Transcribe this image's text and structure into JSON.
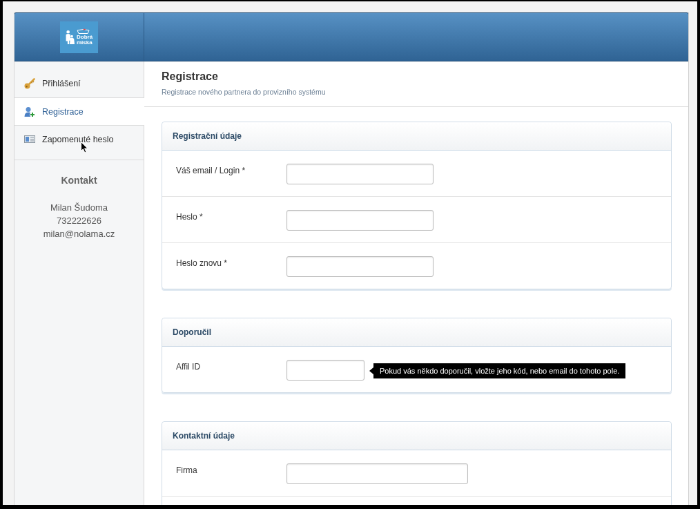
{
  "header": {
    "logo_text": "Dobrá miska"
  },
  "sidebar": {
    "items": [
      {
        "label": "Přihlášení",
        "selected": false
      },
      {
        "label": "Registrace",
        "selected": true
      },
      {
        "label": "Zapomenuté heslo",
        "selected": false
      }
    ],
    "contact": {
      "title": "Kontakt",
      "lines": [
        "Milan Šudoma",
        "732222626",
        "milan@nolama.cz"
      ]
    }
  },
  "page_header": {
    "title": "Registrace",
    "subtitle": "Registrace nového partnera do provizního systému"
  },
  "panels": [
    {
      "title": "Registrační údaje",
      "fields": [
        {
          "label": "Váš email / Login *",
          "kind": "medium"
        },
        {
          "label": "Heslo *",
          "kind": "medium"
        },
        {
          "label": "Heslo znovu *",
          "kind": "medium"
        }
      ]
    },
    {
      "title": "Doporučil",
      "fields": [
        {
          "label": "Affil ID",
          "kind": "short",
          "tooltip": "Pokud vás někdo doporučil, vložte jeho kód, nebo email do tohoto pole."
        }
      ]
    },
    {
      "title": "Kontaktní údaje",
      "fields": [
        {
          "label": "Firma",
          "kind": "long"
        }
      ]
    }
  ]
}
